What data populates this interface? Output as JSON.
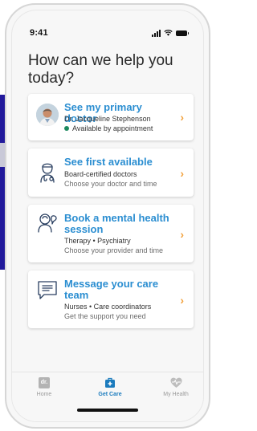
{
  "status_bar": {
    "time": "9:41"
  },
  "heading": "How can we help you today?",
  "cards": [
    {
      "title": "See my primary doctor",
      "line1": "Dr. Jacqueline Stephenson",
      "line2": "Available by appointment",
      "icon": "doctor-avatar",
      "status_color": "#1d8a5f"
    },
    {
      "title": "See first available",
      "line1": "Board-certified doctors",
      "line2": "Choose your doctor and time",
      "icon": "doctor-stethoscope-icon"
    },
    {
      "title": "Book a mental health session",
      "line1": "Therapy • Psychiatry",
      "line2": "Choose your provider and time",
      "icon": "mental-health-icon"
    },
    {
      "title": "Message your care team",
      "line1": "Nurses • Care coordinators",
      "line2": "Get the support you need",
      "icon": "message-icon"
    }
  ],
  "tabs": [
    {
      "label": "Home",
      "icon": "dr-logo-icon",
      "active": false,
      "logo_text": "dr."
    },
    {
      "label": "Get Care",
      "icon": "medical-bag-icon",
      "active": true
    },
    {
      "label": "My Health",
      "icon": "heart-pulse-icon",
      "active": false
    }
  ],
  "colors": {
    "accent": "#2b8ed1",
    "chevron": "#f2a13c",
    "active_tab": "#1b7bbd",
    "available": "#1d8a5f"
  }
}
